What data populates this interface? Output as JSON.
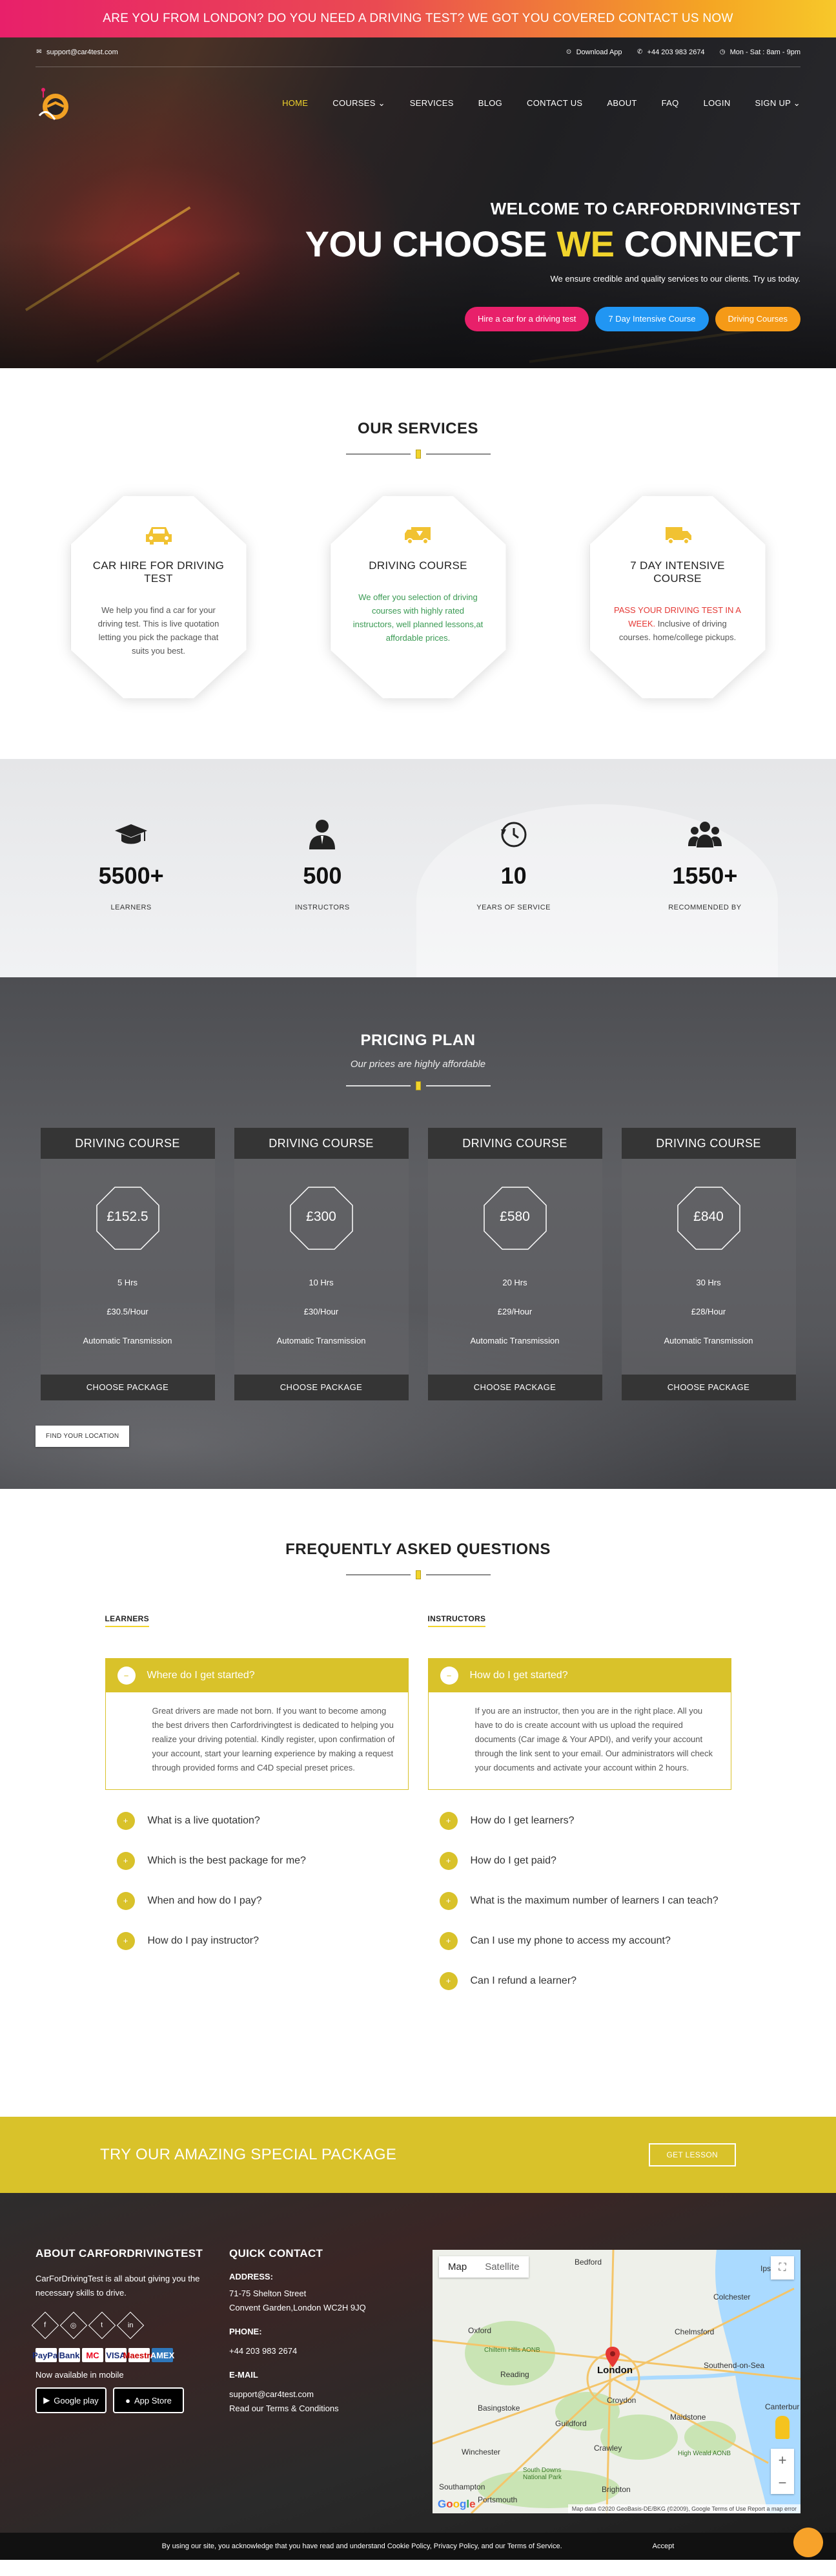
{
  "banner": {
    "text": "ARE YOU FROM LONDON? DO YOU NEED A DRIVING TEST? WE GOT YOU COVERED CONTACT US NOW"
  },
  "topbar": {
    "email": "support@car4test.com",
    "download": "Download App",
    "phone": "+44 203 983 2674",
    "hours": "Mon - Sat : 8am - 9pm"
  },
  "nav": {
    "items": [
      "HOME",
      "COURSES",
      "SERVICES",
      "BLOG",
      "CONTACT US",
      "ABOUT",
      "FAQ",
      "LOGIN",
      "SIGN UP"
    ]
  },
  "hero": {
    "welcome": "WELCOME TO CARFORDRIVINGTEST",
    "headline_a": "YOU CHOOSE ",
    "headline_b": "WE",
    "headline_c": " CONNECT",
    "sub": "We ensure credible and quality services to our clients. Try us today.",
    "btn1": "Hire a car for a driving test",
    "btn2": "7 Day Intensive Course",
    "btn3": "Driving Courses"
  },
  "services": {
    "title": "OUR SERVICES",
    "items": [
      {
        "title": "CAR HIRE FOR DRIVING TEST",
        "desc": "We help you find a car for your driving test. This is live quotation letting you pick the package that suits you best."
      },
      {
        "title": "DRIVING COURSE",
        "desc": "We offer you selection of driving courses with highly rated instructors, well planned lessons,at affordable prices."
      },
      {
        "title": "7 DAY INTENSIVE COURSE",
        "desc_red": "PASS YOUR DRIVING TEST IN A WEEK.",
        "desc": " Inclusive of driving courses. home/college pickups."
      }
    ]
  },
  "stats": [
    {
      "value": "5500+",
      "label": "LEARNERS"
    },
    {
      "value": "500",
      "label": "INSTRUCTORS"
    },
    {
      "value": "10",
      "label": "YEARS OF SERVICE"
    },
    {
      "value": "1550+",
      "label": "RECOMMENDED BY"
    }
  ],
  "pricing": {
    "title": "PRICING PLAN",
    "subtitle": "Our prices are highly affordable",
    "plans": [
      {
        "name": "DRIVING COURSE",
        "price": "£152.5",
        "hours": "5 Hrs",
        "rate": "£30.5/Hour",
        "trans": "Automatic Transmission",
        "cta": "CHOOSE PACKAGE"
      },
      {
        "name": "DRIVING COURSE",
        "price": "£300",
        "hours": "10 Hrs",
        "rate": "£30/Hour",
        "trans": "Automatic Transmission",
        "cta": "CHOOSE PACKAGE"
      },
      {
        "name": "DRIVING COURSE",
        "price": "£580",
        "hours": "20 Hrs",
        "rate": "£29/Hour",
        "trans": "Automatic Transmission",
        "cta": "CHOOSE PACKAGE"
      },
      {
        "name": "DRIVING COURSE",
        "price": "£840",
        "hours": "30 Hrs",
        "rate": "£28/Hour",
        "trans": "Automatic Transmission",
        "cta": "CHOOSE PACKAGE"
      }
    ],
    "find_location": "FIND YOUR LOCATION"
  },
  "faq": {
    "title": "FREQUENTLY ASKED QUESTIONS",
    "learners": {
      "heading": "LEARNERS",
      "open_q": "Where do I get started?",
      "open_a": "Great drivers are made not born. If you want to become among the best drivers then Carfordrivingtest is dedicated to helping you realize your driving potential. Kindly register, upon confirmation of your account, start your learning experience by making a request through provided forms and C4D special preset prices.",
      "questions": [
        "What is a live quotation?",
        "Which is the best package for me?",
        "When and how do I pay?",
        "How do I pay instructor?"
      ]
    },
    "instructors": {
      "heading": "INSTRUCTORS",
      "open_q": "How do I get started?",
      "open_a": "If you are an instructor, then you are in the right place. All you have to do is create account with us upload the required documents (Car image & Your APDI), and verify your account through the link sent to your email. Our administrators will check your documents and activate your account within 2 hours.",
      "questions": [
        "How do I get learners?",
        "How do I get paid?",
        "What is the maximum number of learners I can teach?",
        "Can I use my phone to access my account?",
        "Can I refund a learner?"
      ]
    }
  },
  "special": {
    "text": "TRY OUR AMAZING SPECIAL PACKAGE",
    "btn": "GET LESSON"
  },
  "footer": {
    "about_title": "ABOUT CARFORDRIVINGTEST",
    "about_desc": "CarForDrivingTest is all about giving you the necessary skills to drive.",
    "payments": [
      "PayPal",
      "Bank",
      "MC",
      "VISA",
      "Maestro",
      "AMEX"
    ],
    "mobile": "Now available in mobile",
    "google_play": "Google play",
    "app_store": "App Store",
    "contact_title": "QUICK CONTACT",
    "address_label": "ADDRESS:",
    "address_1": "71-75 Shelton Street",
    "address_2": "Convent Garden,London WC2H 9JQ",
    "phone_label": "PHONE:",
    "phone": "+44 203 983 2674",
    "email_label": "E-MAIL",
    "email": "support@car4test.com",
    "terms": "Read our Terms & Conditions",
    "map": {
      "tab_map": "Map",
      "tab_sat": "Satellite",
      "attribution": "Map data ©2020 GeoBasis-DE/BKG (©2009), Google   Terms of Use   Report a map error",
      "places": [
        "Bedford",
        "Ipsw",
        "Colchester",
        "Oxford",
        "Chiltern Hills AONB",
        "Chelmsford",
        "London",
        "Southend-on-Sea",
        "Reading",
        "Basingstoke",
        "Croydon",
        "Maidstone",
        "Canterbur",
        "Guildford",
        "Winchester",
        "Crawley",
        "High Weald AONB",
        "South Downs National Park",
        "Southampton",
        "Portsmouth",
        "Brighton"
      ]
    }
  },
  "cookie": {
    "text": "By using our site, you acknowledge that you have read and understand Cookie Policy, Privacy Policy, and our Terms of Service.",
    "accept": "Accept"
  },
  "colors": {
    "accent": "#f1d42c",
    "faq_yellow": "#d9c22a",
    "pink": "#e8206a",
    "blue": "#2196f3",
    "orange": "#f59a17"
  }
}
